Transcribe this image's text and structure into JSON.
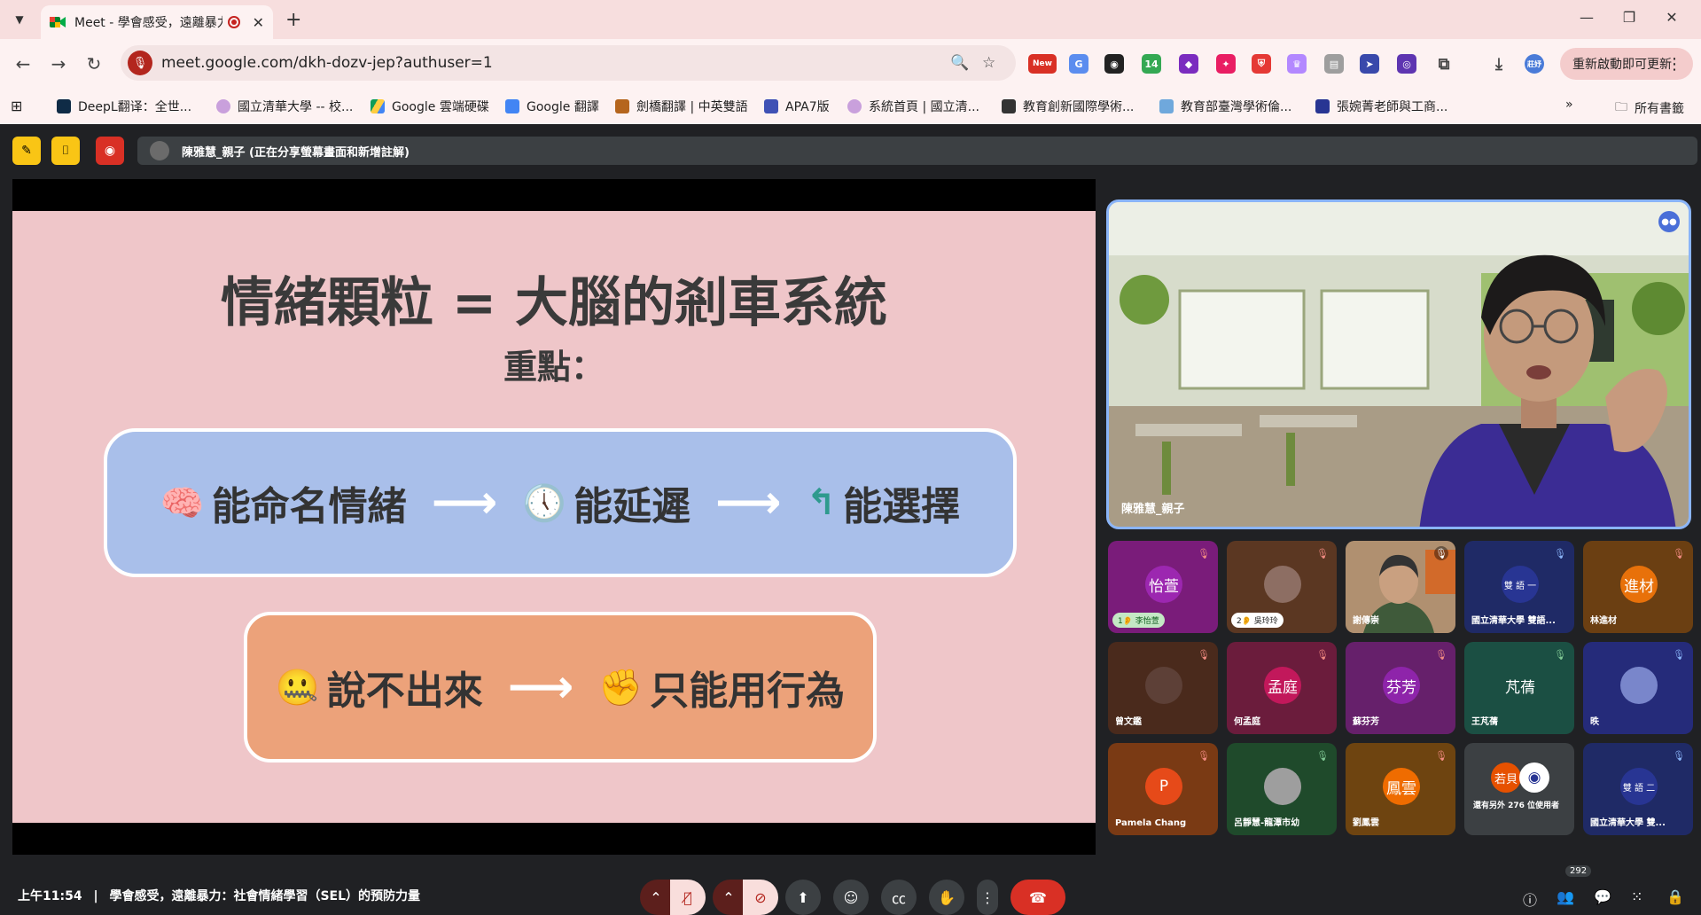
{
  "browser": {
    "tab_title": "Meet - 學會感受，遠離暴力",
    "new_tab_label": "+",
    "url": "meet.google.com/dkh-dozv-jep?authuser=1",
    "update_button_label": "重新啟動即可更新",
    "ext_new_label": "New",
    "ext_14_label": "14",
    "profile_label": "莊妤",
    "bookmarks": [
      "DeepL翻译：全世...",
      "國立清華大學 -- 校...",
      "Google 雲端硬碟",
      "Google 翻譯",
      "劍橋翻譯 | 中英雙語",
      "APA7版",
      "系統首頁 | 國立清...",
      "教育創新國際學術...",
      "教育部臺灣學術倫...",
      "張婉菁老師與工商..."
    ],
    "all_bookmarks_label": "所有書籤",
    "more_bookmarks_label": "»"
  },
  "meet": {
    "presenting_text": "陳雅慧_親子 (正在分享螢幕畫面和新增註解)",
    "slide": {
      "title": "情緒顆粒 = 大腦的剎車系統",
      "subtitle": "重點：",
      "row1": [
        {
          "emoji": "🧠",
          "text": "能命名情緒"
        },
        {
          "emoji": "🕔",
          "text": "能延遲"
        },
        {
          "emoji": "↰",
          "text": "能選擇"
        }
      ],
      "row2": [
        {
          "emoji": "🤐",
          "text": "說不出來"
        },
        {
          "emoji": "✊",
          "text": "只能用行為"
        }
      ],
      "arrow": "⟶"
    },
    "main_speaker": "陳雅慧_親子",
    "tiles": [
      {
        "name": "李怡萱",
        "initials": "怡萱",
        "badge": "1👂 李怡萱",
        "bg": "#7a1c7a",
        "circle": "#9c27b0"
      },
      {
        "name": "吳玲玲",
        "initials": "",
        "badge": "2👂 吳玲玲",
        "bg": "#5b3722",
        "circle": "#8d6e63"
      },
      {
        "name": "謝傳崇",
        "initials": "",
        "badge": "",
        "bg": "#7a6248",
        "circle": ""
      },
      {
        "name": "國立清華大學 雙語...",
        "initials": "雙 語 一",
        "badge": "",
        "bg": "#1f2a66",
        "circle": "#283593"
      },
      {
        "name": "林進材",
        "initials": "進材",
        "badge": "",
        "bg": "#6b3f12",
        "circle": "#e8710a"
      },
      {
        "name": "曾文鑑",
        "initials": "",
        "badge": "",
        "bg": "#4a2a1c",
        "circle": "#5d4037"
      },
      {
        "name": "何孟庭",
        "initials": "孟庭",
        "badge": "",
        "bg": "#6b1c3c",
        "circle": "#c2185b"
      },
      {
        "name": "蘇芬芳",
        "initials": "芬芳",
        "badge": "",
        "bg": "#66206b",
        "circle": "#8e24aa"
      },
      {
        "name": "王芃蒨",
        "initials": "芃蒨",
        "badge": "",
        "bg": "#1b4f43",
        "circle": "#1b5e20"
      },
      {
        "name": "昳",
        "initials": "",
        "badge": "",
        "bg": "#252b7a",
        "circle": "#7986cb"
      },
      {
        "name": "Pamela Chang",
        "initials": "P",
        "badge": "",
        "bg": "#7a3a14",
        "circle": "#e64a19"
      },
      {
        "name": "呂靜慧-龍潭市幼",
        "initials": "",
        "badge": "",
        "bg": "#1f4a2b",
        "circle": "#9e9e9e"
      },
      {
        "name": "劉鳳雲",
        "initials": "鳳雲",
        "badge": "",
        "bg": "#6e4410",
        "circle": "#ef6c00"
      },
      {
        "name": "還有另外 276 位使用者",
        "initials": "若貝",
        "badge": "",
        "bg": "#3c4043",
        "circle": "#e65100"
      },
      {
        "name": "國立清華大學 雙...",
        "initials": "雙 語 二",
        "badge": "",
        "bg": "#1f2a66",
        "circle": "#283593"
      }
    ],
    "time": "上午11:54",
    "separator": "|",
    "meeting_title": "學會感受，遠離暴力：社會情緒學習（SEL）的預防力量",
    "participants_count": "292"
  }
}
